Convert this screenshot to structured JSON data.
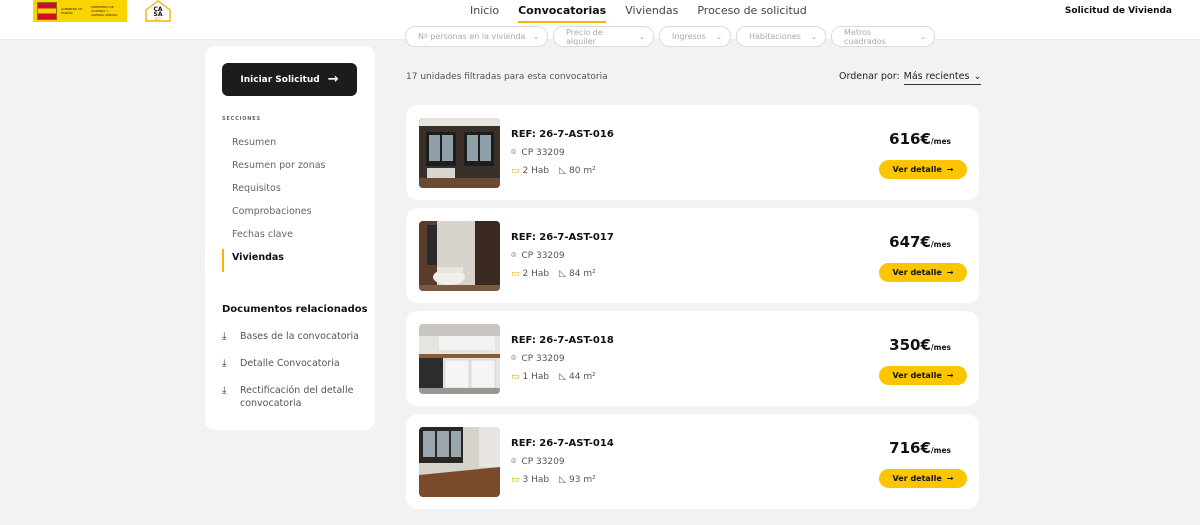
{
  "nav": {
    "items": [
      "Inicio",
      "Convocatorias",
      "Viviendas",
      "Proceso de solicitud"
    ],
    "active_index": 1,
    "right_link": "Solicitud de Vivienda"
  },
  "logos": {
    "gov": [
      "GOBIERNO DE ESPAÑA",
      "MINISTERIO DE VIVIENDA Y AGENDA URBANA"
    ],
    "casa": [
      "CA",
      "SA",
      "47"
    ]
  },
  "filters": [
    "Nº personas en la vivienda",
    "Precio de alquiler",
    "Ingresos",
    "Habitaciones",
    "Metros cuadrados"
  ],
  "sidebar": {
    "start_button": "Iniciar Solicitud",
    "sections_title": "SECCIONES",
    "sections": [
      "Resumen",
      "Resumen por zonas",
      "Requisitos",
      "Comprobaciones",
      "Fechas clave",
      "Viviendas"
    ],
    "active_section": 5,
    "docs_title": "Documentos relacionados",
    "docs": [
      "Bases de la convocatoria",
      "Detalle Convocatoria",
      "Rectificación del detalle convocatoria"
    ]
  },
  "main": {
    "count_text": "17 unidades filtradas para esta convocatoria",
    "order_label": "Ordenar por:",
    "order_value": "Más recientes",
    "detail_label": "Ver detalle",
    "price_unit": "/mes",
    "listings": [
      {
        "ref": "REF: 26-7-AST-016",
        "cp": "CP 33209",
        "rooms": "2 Hab",
        "area": "80 m²",
        "price": "616€"
      },
      {
        "ref": "REF: 26-7-AST-017",
        "cp": "CP 33209",
        "rooms": "2 Hab",
        "area": "84 m²",
        "price": "647€"
      },
      {
        "ref": "REF: 26-7-AST-018",
        "cp": "CP 33209",
        "rooms": "1 Hab",
        "area": "44 m²",
        "price": "350€"
      },
      {
        "ref": "REF: 26-7-AST-014",
        "cp": "CP 33209",
        "rooms": "3 Hab",
        "area": "93 m²",
        "price": "716€"
      }
    ]
  },
  "colors": {
    "accent": "#fbc500",
    "dark": "#1c1c1c",
    "background": "#f2f2f2"
  }
}
